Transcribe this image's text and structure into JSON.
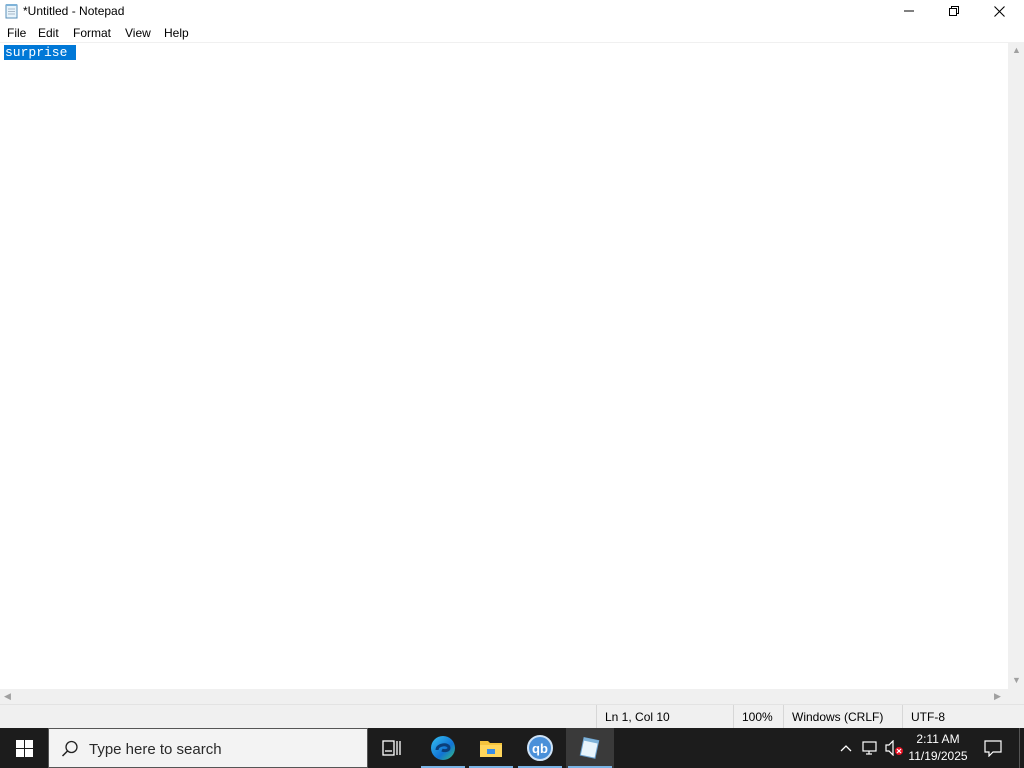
{
  "window": {
    "title": "*Untitled - Notepad",
    "controls": [
      "minimize-icon",
      "restore-icon",
      "close-icon"
    ]
  },
  "menu": {
    "file": "File",
    "edit": "Edit",
    "format": "Format",
    "view": "View",
    "help": "Help"
  },
  "editor": {
    "selected_text": "surprise ",
    "selection_color": "#0078d7"
  },
  "status": {
    "position": "Ln 1, Col 10",
    "zoom": "100%",
    "line_ending": "Windows (CRLF)",
    "encoding": "UTF-8"
  },
  "taskbar": {
    "search_placeholder": "Type here to search",
    "apps": [
      "task-view-icon",
      "edge-icon",
      "file-explorer-icon",
      "qbittorrent-icon",
      "notepad-icon"
    ],
    "qb_label": "qb",
    "clock_time": "2:11 AM",
    "clock_date": "11/19/2025",
    "accent": "#7ab4e6"
  }
}
